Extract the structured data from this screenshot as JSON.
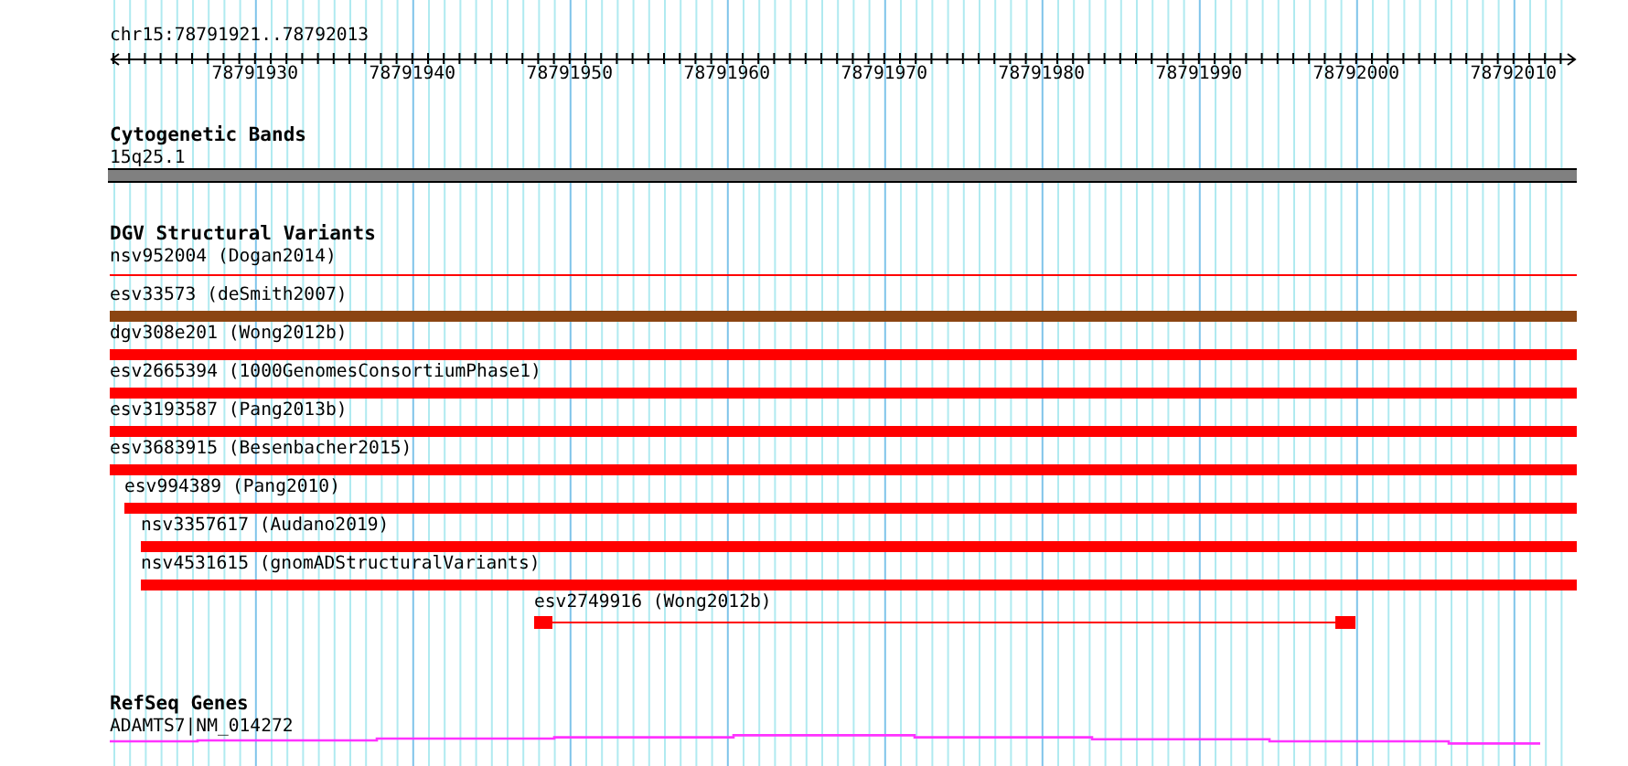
{
  "location": "chr15:78791921..78792013",
  "ruler": {
    "labels": [
      "78791930",
      "78791940",
      "78791950",
      "78791960",
      "78791970",
      "78791980",
      "78791990",
      "78792000",
      "78792010"
    ]
  },
  "tracks": [
    {
      "title": "Cytogenetic Bands",
      "features": [
        {
          "kind": "band",
          "label": "15q25.1"
        }
      ]
    },
    {
      "title": "DGV Structural Variants",
      "features": [
        {
          "kind": "line",
          "label": "nsv952004 (Dogan2014)",
          "color": "#ff0000"
        },
        {
          "kind": "bar",
          "label": "esv33573 (deSmith2007)",
          "color": "#8b4513"
        },
        {
          "kind": "bar",
          "label": "dgv308e201 (Wong2012b)",
          "color": "#ff0000"
        },
        {
          "kind": "bar",
          "label": "esv2665394 (1000GenomesConsortiumPhase1)",
          "color": "#ff0000"
        },
        {
          "kind": "bar",
          "label": "esv3193587 (Pang2013b)",
          "color": "#ff0000"
        },
        {
          "kind": "bar",
          "label": "esv3683915 (Besenbacher2015)",
          "color": "#ff0000"
        },
        {
          "kind": "bar",
          "label": "esv994389 (Pang2010)",
          "color": "#ff0000"
        },
        {
          "kind": "bar",
          "label": "nsv3357617 (Audano2019)",
          "color": "#ff0000"
        },
        {
          "kind": "bar",
          "label": "nsv4531615 (gnomADStructuralVariants)",
          "color": "#ff0000"
        },
        {
          "kind": "gapped",
          "label": "esv2749916 (Wong2012b)",
          "color": "#ff0000"
        }
      ]
    },
    {
      "title": "RefSeq Genes",
      "features": [
        {
          "kind": "gene",
          "label": "ADAMTS7|NM_014272"
        }
      ]
    }
  ]
}
